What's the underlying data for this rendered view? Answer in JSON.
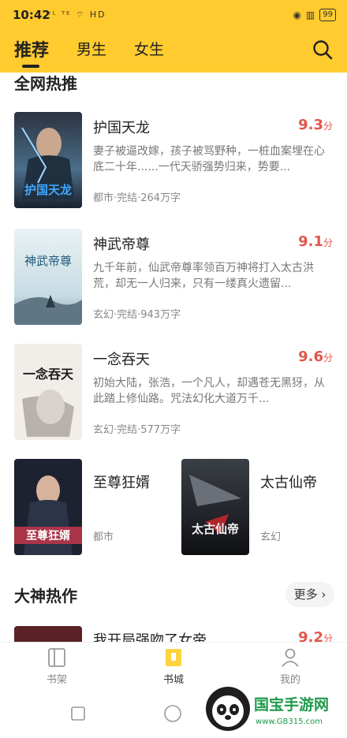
{
  "status_bar": {
    "time": "10:42",
    "left_icons": "ᵛᴸ ᵀᴱ  ⌔  HD",
    "battery": "99"
  },
  "header": {
    "tabs": [
      {
        "label": "推荐",
        "active": true
      },
      {
        "label": "男生",
        "active": false
      },
      {
        "label": "女生",
        "active": false
      }
    ],
    "accent_color": "#FFCB2E"
  },
  "section1": {
    "title": "全网热推"
  },
  "books": [
    {
      "title": "护国天龙",
      "score": "9.3",
      "score_unit": "分",
      "desc": "妻子被逼改嫁，孩子被骂野种，一桩血案埋在心底二十年......一代天骄强势归来，势要...",
      "meta": "都市·完结·264万字",
      "cover_text": "护国天龙"
    },
    {
      "title": "神武帝尊",
      "score": "9.1",
      "score_unit": "分",
      "desc": "九千年前，仙武帝尊率领百万神将打入太古洪荒，却无一人归来，只有一缕真火遗留...",
      "meta": "玄幻·完结·943万字",
      "cover_text": "神武帝尊"
    },
    {
      "title": "一念吞天",
      "score": "9.6",
      "score_unit": "分",
      "desc": "初始大陆，张浩，一个凡人，却遇苍无黑犽，从此踏上修仙路。咒法幻化大道万千...",
      "meta": "玄幻·完结·577万字",
      "cover_text": "一念吞天"
    }
  ],
  "pair_books": [
    {
      "title": "至尊狂婿",
      "meta": "都市",
      "cover_text": "至尊狂婿"
    },
    {
      "title": "太古仙帝",
      "meta": "玄幻",
      "cover_text": "太古仙帝"
    }
  ],
  "section2": {
    "title": "大神热作",
    "more": "更多 ›"
  },
  "peek_book": {
    "title": "我开局强吻了女帝",
    "score": "9.2",
    "score_unit": "分"
  },
  "bottom_nav": [
    {
      "label": "书架",
      "active": false
    },
    {
      "label": "书城",
      "active": true
    },
    {
      "label": "我的",
      "active": false
    }
  ],
  "watermark": {
    "brand": "国宝手游网",
    "url": "www.GB315.com"
  }
}
